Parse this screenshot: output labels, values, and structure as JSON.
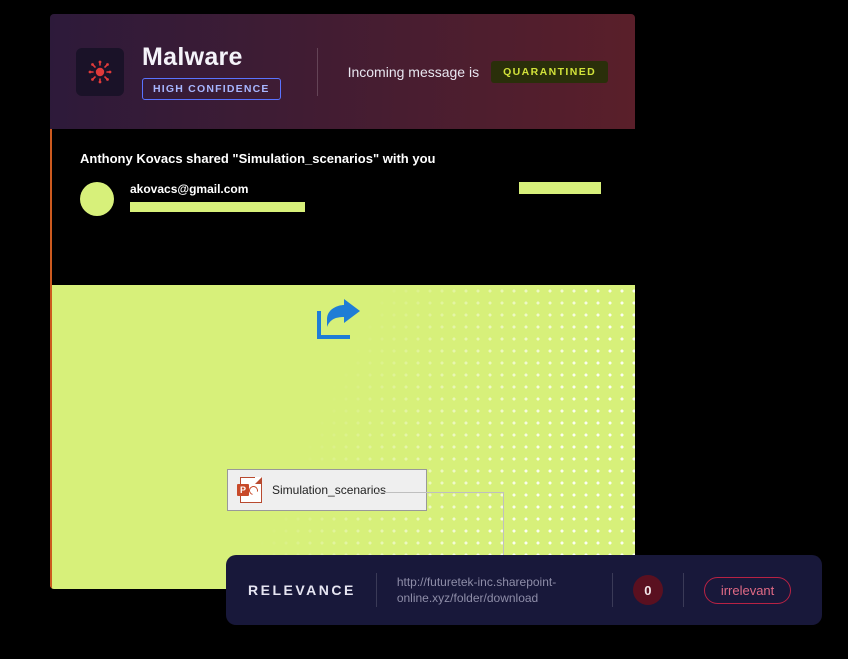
{
  "threat": {
    "title": "Malware",
    "confidence": "HIGH CONFIDENCE",
    "status_prefix": "Incoming message is",
    "status_badge": "QUARANTINED"
  },
  "email": {
    "subject": "Anthony Kovacs shared \"Simulation_scenarios\" with you",
    "sender": "akovacs@gmail.com"
  },
  "attachment": {
    "filename": "Simulation_scenarios",
    "icon": "powerpoint"
  },
  "relevance": {
    "label": "RELEVANCE",
    "url": "http://futuretek-inc.sharepoint-online.xyz/folder/download",
    "count": "0",
    "badge": "irrelevant"
  }
}
